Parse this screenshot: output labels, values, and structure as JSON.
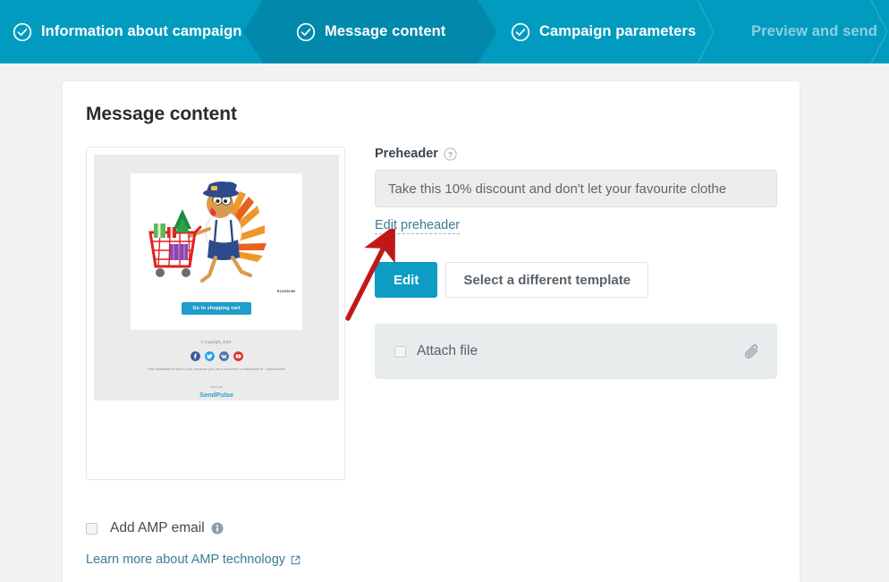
{
  "steps": [
    {
      "label": "Information about campaign",
      "icon": "check-circle-icon",
      "state": "completed"
    },
    {
      "label": "Message content",
      "icon": "check-circle-icon",
      "state": "active"
    },
    {
      "label": "Campaign parameters",
      "icon": "check-circle-icon",
      "state": "completed"
    },
    {
      "label": "Preview and send",
      "icon": "",
      "state": "disabled"
    }
  ],
  "page": {
    "title": "Message content"
  },
  "preheader": {
    "label": "Preheader",
    "help_icon": "question-circle-icon",
    "value": "Take this 10% discount and don't let your favourite clothe",
    "placeholder": "Take this 10% discount and don't let your favourite clothe",
    "edit_link": "Edit preheader"
  },
  "buttons": {
    "edit": "Edit",
    "select_template": "Select a different template"
  },
  "attach": {
    "label": "Attach file",
    "checked": false,
    "icon": "paperclip-icon"
  },
  "amp": {
    "checkbox_label": "Add AMP email",
    "info_icon": "info-circle-icon",
    "link": "Learn more about AMP technology",
    "link_icon": "external-link-icon",
    "checked": false
  },
  "email_preview": {
    "tiny_code": "R1190515M",
    "cta": "Go to shopping cart",
    "copyright": "© Copyright, 2019.",
    "disclaimer": "This newsletter is sent to you, because you are a customer or subscriber of . Unsubscribe",
    "sent_via": "Sent via",
    "brand": "SendPulse",
    "socials": [
      {
        "name": "facebook-icon",
        "color": "#3b5998"
      },
      {
        "name": "twitter-icon",
        "color": "#1da1f2"
      },
      {
        "name": "vk-icon",
        "color": "#4a76a8"
      },
      {
        "name": "youtube-icon",
        "color": "#e02f2f"
      }
    ]
  },
  "colors": {
    "header": "#029bc0",
    "header_active": "#0089ab",
    "accent": "#0c9cc4",
    "link": "#3d7b94",
    "annotation": "#c01818"
  }
}
